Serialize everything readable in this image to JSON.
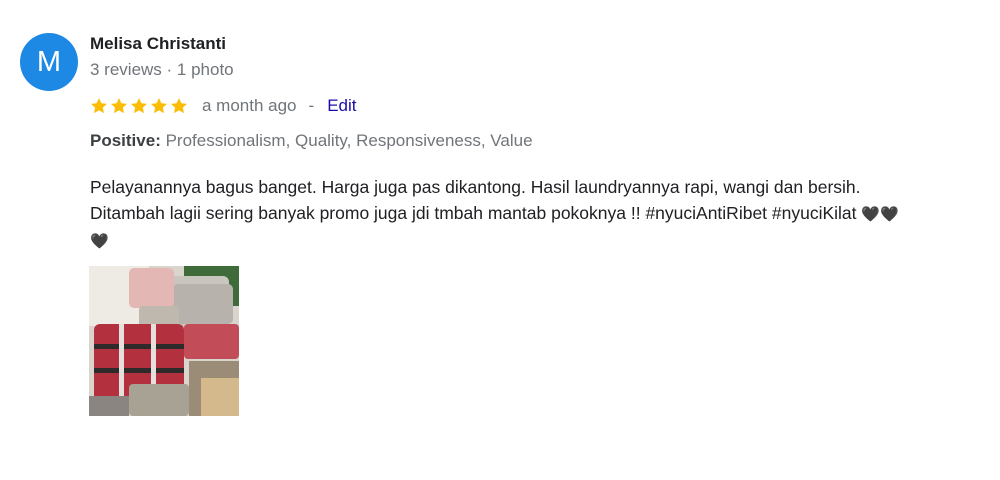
{
  "reviewer": {
    "initial": "M",
    "name": "Melisa Christanti",
    "meta": "3 reviews · 1 photo",
    "avatar_color": "#1e88e5"
  },
  "rating": {
    "stars": 5,
    "max_stars": 5,
    "star_color": "#fbbc04",
    "time": "a month ago",
    "separator": "-",
    "edit_label": "Edit"
  },
  "positive": {
    "label": "Positive:",
    "items": "Professionalism, Quality, Responsiveness, Value"
  },
  "review_text": {
    "line1": "Pelayanannya bagus banget. Harga juga pas dikantong. Hasil laundryannya rapi, wangi dan bersih.",
    "line2": "Ditambah lagii sering banyak promo juga jdi tmbah mantab pokoknya !! #nyuciAntiRibet #nyuciKilat",
    "hearts_a": "🖤🖤",
    "hearts_b": "🖤"
  },
  "photo": {
    "icon": "laundry-photo-thumbnail"
  }
}
